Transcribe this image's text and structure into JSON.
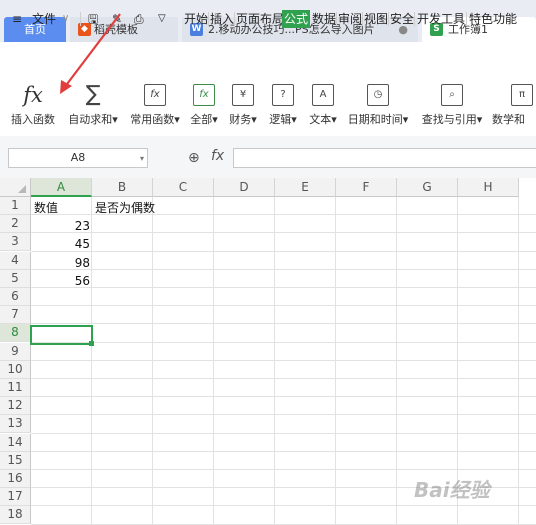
{
  "tabs": [
    {
      "label": "首页"
    },
    {
      "label": "稻壳模板"
    },
    {
      "label": "2.移动办公技巧...PS怎么导入图片"
    },
    {
      "label": "工作簿1"
    }
  ],
  "menu": {
    "file_label": "文件",
    "items": [
      "开始",
      "插入",
      "页面布局",
      "公式",
      "数据",
      "审阅",
      "视图",
      "安全",
      "开发工具",
      "特色功能"
    ],
    "active": "公式"
  },
  "ribbon": [
    {
      "label": "插入函数",
      "icon": "fx-icon"
    },
    {
      "label": "自动求和▾",
      "icon": "sigma-icon"
    },
    {
      "label": "常用函数▾",
      "icon": "star-function-icon"
    },
    {
      "label": "全部▾",
      "icon": "function-book-icon"
    },
    {
      "label": "财务▾",
      "icon": "finance-book-icon"
    },
    {
      "label": "逻辑▾",
      "icon": "logic-book-icon"
    },
    {
      "label": "文本▾",
      "icon": "text-book-icon"
    },
    {
      "label": "日期和时间▾",
      "icon": "clock-book-icon"
    },
    {
      "label": "查找与引用▾",
      "icon": "search-book-icon"
    },
    {
      "label": "数学和",
      "icon": "math-book-icon"
    }
  ],
  "formula_bar": {
    "name_box": "A8",
    "fx": "fx",
    "formula": ""
  },
  "columns": [
    "A",
    "B",
    "C",
    "D",
    "E",
    "F",
    "G",
    "H"
  ],
  "rows": [
    "1",
    "2",
    "3",
    "4",
    "5",
    "6",
    "7",
    "8",
    "9",
    "10",
    "11",
    "12",
    "13",
    "14",
    "15",
    "16",
    "17",
    "18"
  ],
  "cells": {
    "A1": "数值",
    "B1": "是否为偶数",
    "A2": "23",
    "A3": "45",
    "A4": "98",
    "A5": "56"
  },
  "selected_cell": "A8",
  "watermark": "Bai经验"
}
